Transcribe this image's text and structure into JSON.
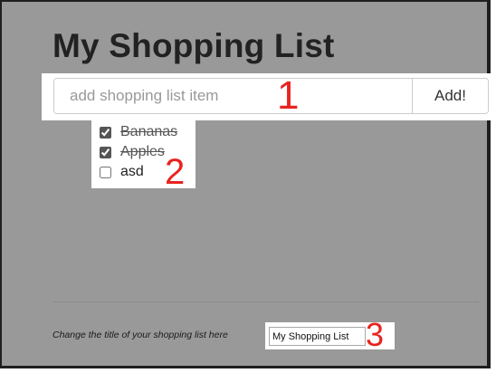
{
  "page": {
    "title": "My Shopping List"
  },
  "add_item": {
    "placeholder": "add shopping list item",
    "value": "",
    "button_label": "Add!"
  },
  "list": {
    "items": [
      {
        "label": "Bananas",
        "checked": true
      },
      {
        "label": "Apples",
        "checked": true
      },
      {
        "label": "asd",
        "checked": false
      }
    ]
  },
  "title_editor": {
    "label": "Change the title of your shopping list here",
    "value": "My Shopping List"
  },
  "callouts": [
    "1",
    "2",
    "3"
  ],
  "colors": {
    "background": "#999999",
    "callout": "#e8231f"
  }
}
